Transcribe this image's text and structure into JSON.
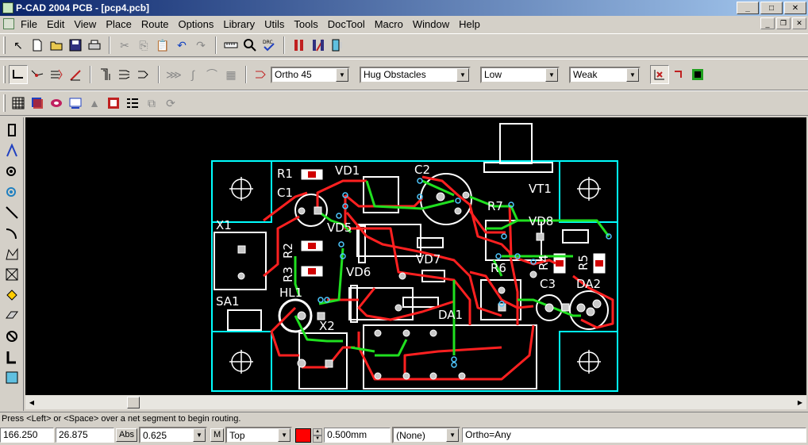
{
  "window": {
    "title": "P-CAD 2004 PCB - [pcp4.pcb]",
    "min": "_",
    "max": "□",
    "close": "✕"
  },
  "menu": [
    "File",
    "Edit",
    "View",
    "Place",
    "Route",
    "Options",
    "Library",
    "Utils",
    "Tools",
    "DocTool",
    "Macro",
    "Window",
    "Help"
  ],
  "route_toolbar": {
    "ortho": "Ortho 45",
    "obstacles": "Hug Obstacles",
    "level": "Low",
    "strength": "Weak"
  },
  "status_line": "Press <Left> or <Space> over a net segment to begin routing.",
  "statusbar": {
    "x": "166.250",
    "y": "26.875",
    "abs": "Abs",
    "grid": "0.625",
    "m": "M",
    "layer": "Top",
    "width": "0.500mm",
    "net": "(None)",
    "ortho": "Ortho=Any"
  },
  "board_labels": [
    "R1",
    "VD1",
    "C2",
    "C1",
    "VT1",
    "R7",
    "X1",
    "VD5",
    "VD8",
    "R2",
    "VD7",
    "R3",
    "R6",
    "R4",
    "R5",
    "VD6",
    "C3",
    "DA2",
    "HL1",
    "SA1",
    "X2",
    "DA1"
  ],
  "colors": {
    "board_outline": "#00ffff",
    "top_trace": "#ff2020",
    "bottom_trace": "#20e020",
    "silk": "#ffffff",
    "via": "#4fc8ff"
  }
}
